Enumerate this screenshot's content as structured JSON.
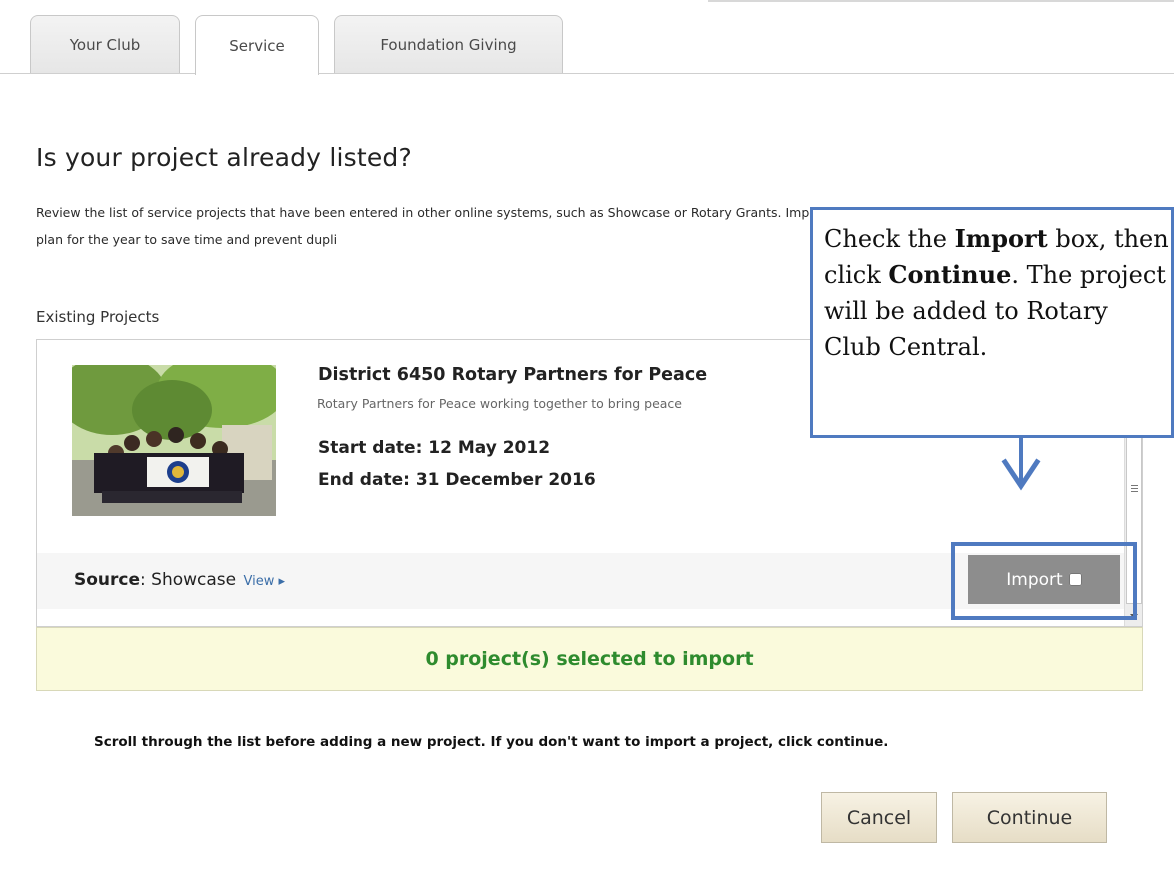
{
  "tabs": [
    {
      "label": "Your Club",
      "active": false
    },
    {
      "label": "Service",
      "active": true
    },
    {
      "label": "Foundation Giving",
      "active": false
    }
  ],
  "page": {
    "title": "Is your project already listed?",
    "intro": "Review the list of service projects that have been entered in other online systems, such as Showcase or Rotary Grants. Import the projects you want to include in your club's plan for the year to save time and prevent dupli",
    "section_label": "Existing Projects"
  },
  "project": {
    "title": "District 6450 Rotary Partners for Peace",
    "description": "Rotary Partners for Peace working together to bring peace",
    "start_date": "Start date: 12 May 2012",
    "end_date": "End date: 31 December 2016",
    "source_label": "Source",
    "source_value": "Showcase",
    "view_link": "View ▸",
    "import_label": "Import",
    "import_checked": false
  },
  "selection": {
    "status": "0 project(s) selected to import"
  },
  "note": "Scroll through the list before adding a new project. If you don't want to import a project, click continue.",
  "buttons": {
    "cancel": "Cancel",
    "continue": "Continue"
  },
  "callout": {
    "t1": "Check the ",
    "b1": "Import",
    "t2": " box, then click ",
    "b2": "Continue",
    "t3": ". The project will be added to Rotary Club Central."
  },
  "colors": {
    "accent": "#4f7ac0",
    "status_text": "#2e8b2e",
    "selected_bar_bg": "#fafadc"
  }
}
